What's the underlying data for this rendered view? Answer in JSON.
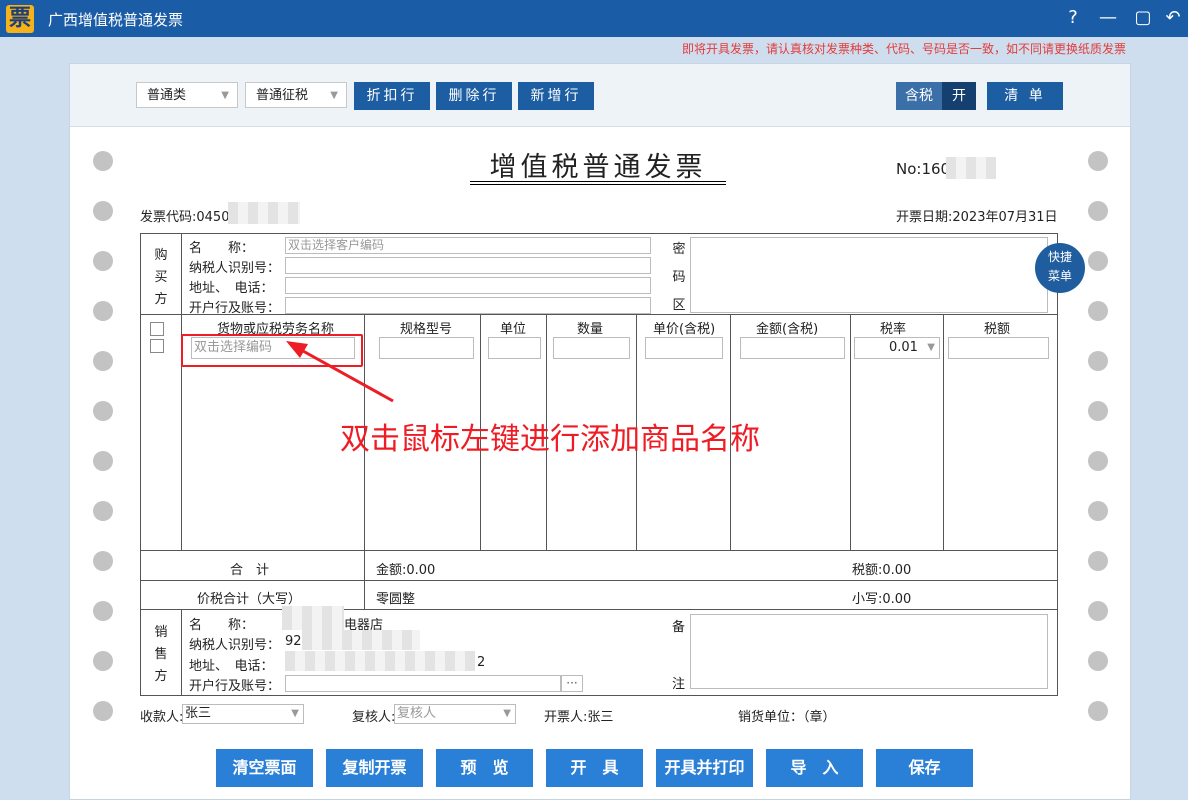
{
  "app": {
    "logo_char": "票",
    "title": "广西增值税普通发票"
  },
  "window_controls": {
    "help": "?",
    "minimize": "—",
    "maximize": "▢",
    "back": "↶"
  },
  "notice": "即将开具发票，请认真核对发票种类、代码、号码是否一致，如不同请更换纸质发票",
  "toolbar": {
    "invoice_type": "普通类",
    "tax_type": "普通征税",
    "discount_line": "折扣行",
    "delete_line": "删除行",
    "add_line": "新增行",
    "tax_incl": "含税",
    "tax_toggle": "开",
    "list": "清 单"
  },
  "invoice": {
    "title": "增值税普通发票",
    "no_label": "No:160",
    "code_label": "发票代码:0450",
    "date_label": "开票日期:2023年07月31日"
  },
  "buyer": {
    "side_label": [
      "购",
      "买",
      "方"
    ],
    "name_label": "名　　称：",
    "name_placeholder": "双击选择客户编码",
    "taxid_label": "纳税人识别号：",
    "addr_label": "地址、　电话：",
    "bank_label": "开户行及账号：",
    "password_label": [
      "密",
      "码",
      "区"
    ]
  },
  "quick_menu": [
    "快捷",
    "菜单"
  ],
  "items": {
    "headers": [
      "货物或应税劳务名称",
      "规格型号",
      "单位",
      "数量",
      "单价(含税)",
      "金额(含税)",
      "税率",
      "税额"
    ],
    "name_placeholder": "双击选择编码",
    "tax_rate": "0.01"
  },
  "totals": {
    "total_label": "合　计",
    "amount": "金额:0.00",
    "tax": "税额:0.00",
    "grand_label": "价税合计（大写）",
    "grand_upper": "零圆整",
    "grand_lower": "小写:0.00"
  },
  "seller": {
    "side_label": [
      "销",
      "售",
      "方"
    ],
    "name_label": "名　　称：",
    "name_value": "电器店",
    "taxid_label": "纳税人识别号：",
    "taxid_value": "92",
    "addr_label": "地址、　电话：",
    "addr_value": "2",
    "bank_label": "开户行及账号：",
    "bank_btn": "···",
    "remark_label": [
      "备",
      "注"
    ]
  },
  "signatures": {
    "payee_label": "收款人:",
    "payee": "张三",
    "reviewer_label": "复核人:",
    "reviewer_placeholder": "复核人",
    "drawer": "开票人:张三",
    "seller_unit": "销货单位：（章）"
  },
  "actions": [
    "清空票面",
    "复制开票",
    "预　览",
    "开　具",
    "开具并打印",
    "导　入",
    "保存"
  ],
  "annotation": "双击鼠标左键进行添加商品名称",
  "colors": {
    "titlebar": "#1b5ca6",
    "button": "#1d5ea3",
    "action": "#2a7fd6",
    "annotation": "#ee1c24"
  }
}
